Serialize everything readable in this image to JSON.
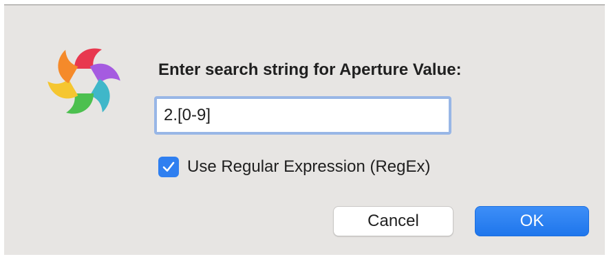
{
  "dialog": {
    "prompt": "Enter search string for Aperture Value:",
    "search_value": "2.[0-9]",
    "regex_label": "Use Regular Expression (RegEx)",
    "regex_checked": true,
    "cancel_label": "Cancel",
    "ok_label": "OK",
    "app_icon": "app-logo-icon",
    "checkbox_icon": "checkmark-icon"
  },
  "colors": {
    "accent": "#2f7ff0",
    "dialog_background": "#e7e5e3",
    "focus_ring": "#98b6e6"
  }
}
